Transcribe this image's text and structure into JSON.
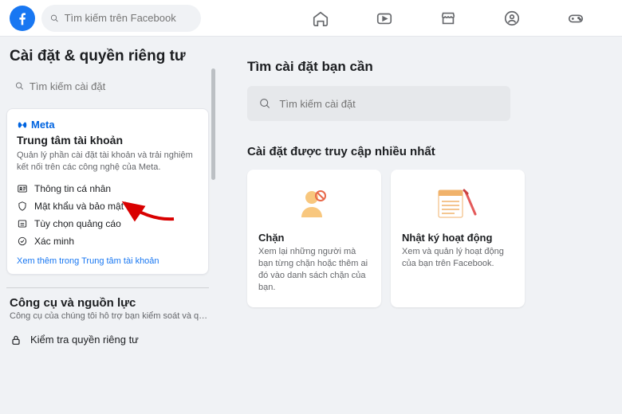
{
  "topbar": {
    "search_placeholder": "Tìm kiếm trên Facebook"
  },
  "sidebar": {
    "title": "Cài đặt & quyền riêng tư",
    "search_placeholder": "Tìm kiếm cài đặt",
    "meta_brand": "Meta",
    "account_center": {
      "title": "Trung tâm tài khoản",
      "desc": "Quản lý phần cài đặt tài khoản và trải nghiệm kết nối trên các công nghệ của Meta.",
      "items": [
        {
          "label": "Thông tin cá nhân"
        },
        {
          "label": "Mật khẩu và bảo mật"
        },
        {
          "label": "Tùy chọn quảng cáo"
        },
        {
          "label": "Xác minh"
        }
      ],
      "see_more": "Xem thêm trong Trung tâm tài khoản"
    },
    "tools": {
      "title": "Công cụ và nguồn lực",
      "desc": "Công cụ của chúng tôi hỗ trợ bạn kiểm soát và quản l...",
      "items": [
        {
          "label": "Kiểm tra quyền riêng tư"
        }
      ]
    }
  },
  "main": {
    "search_title": "Tìm cài đặt bạn cần",
    "search_placeholder": "Tìm kiếm cài đặt",
    "most_accessed_title": "Cài đặt được truy cập nhiều nhất",
    "cards": [
      {
        "title": "Chặn",
        "desc": "Xem lại những người mà bạn từng chặn hoặc thêm ai đó vào danh sách chặn của bạn."
      },
      {
        "title": "Nhật ký hoạt động",
        "desc": "Xem và quản lý hoạt động của bạn trên Facebook."
      }
    ]
  }
}
